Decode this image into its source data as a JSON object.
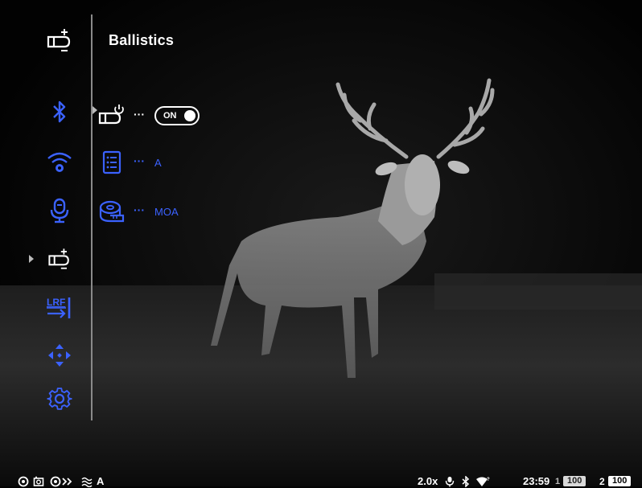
{
  "header": {
    "title": "Ballistics",
    "icon": "bullet-plus-minus-icon"
  },
  "sidebar": {
    "items": [
      {
        "name": "bluetooth",
        "icon": "bluetooth-icon"
      },
      {
        "name": "wifi-settings",
        "icon": "wifi-gear-icon"
      },
      {
        "name": "microphone",
        "icon": "microphone-icon"
      },
      {
        "name": "ballistics",
        "icon": "bullet-plus-minus-icon",
        "selected": true
      },
      {
        "name": "lrf",
        "icon": "lrf-icon",
        "label": "LRF"
      },
      {
        "name": "zeroing",
        "icon": "crosshair-arrows-icon"
      },
      {
        "name": "settings",
        "icon": "gear-icon"
      }
    ]
  },
  "options": {
    "power": {
      "icon": "bullet-power-icon",
      "dots": "···",
      "value": "ON"
    },
    "profile": {
      "icon": "list-icon",
      "dots": "···",
      "value": "A"
    },
    "units": {
      "icon": "tape-measure-icon",
      "dots": "···",
      "value": "MOA"
    }
  },
  "status": {
    "left_text": "A",
    "zoom": "2.0x",
    "time": "23:59",
    "battery1_label": "1",
    "battery1_value": "100",
    "battery2_label": "2",
    "battery2_value": "100"
  },
  "colors": {
    "accent": "#3b62ff",
    "text": "#ffffff",
    "background": "#000000"
  }
}
